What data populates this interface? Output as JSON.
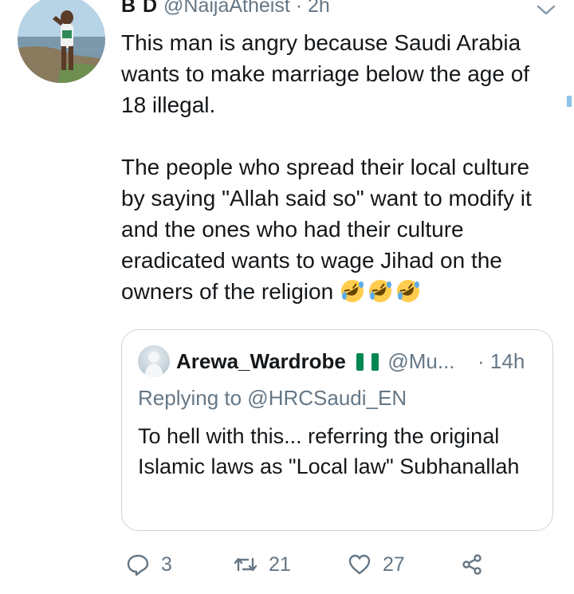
{
  "tweet": {
    "display_name": "B D",
    "handle": "@NaijaAtheist",
    "separator": "·",
    "time": "2h",
    "text": "This man is angry because Saudi Arabia wants to make marriage below the age of 18 illegal.\n\nThe people who spread their local culture by saying \"Allah said so\" want to modify it and the ones who had their culture eradicated wants to wage Jihad on the owners of the religion ",
    "emoji_count": 3,
    "emoji_name": "rolling-on-the-floor-laughing"
  },
  "quoted": {
    "display_name": "Arewa_Wardrobe",
    "flag": "nigeria-flag",
    "handle": "@Mu...",
    "separator": "·",
    "time": "14h",
    "replying_to": "Replying to @HRCSaudi_EN",
    "text": "To hell with this... referring the original Islamic laws as \"Local law\" Subhanallah"
  },
  "actions": {
    "reply_count": "3",
    "retweet_count": "21",
    "like_count": "27"
  },
  "colors": {
    "text": "#14171a",
    "secondary": "#657786",
    "border": "#ccd6dd",
    "nigeria_green": "#008751"
  }
}
